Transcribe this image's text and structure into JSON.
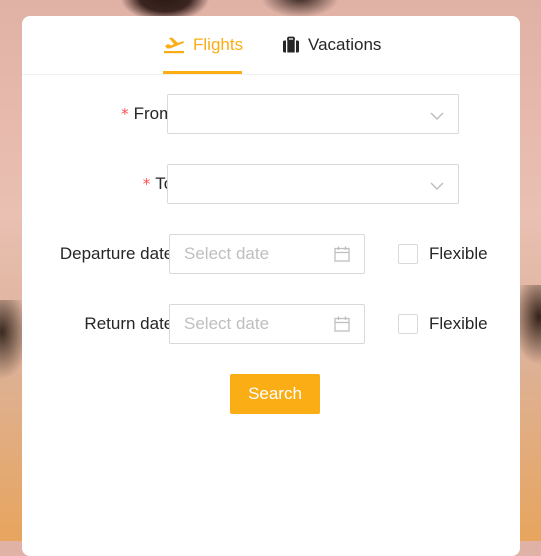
{
  "tabs": [
    {
      "label": "Flights",
      "icon": "airplane-icon",
      "active": true
    },
    {
      "label": "Vacations",
      "icon": "suitcase-icon",
      "active": false
    }
  ],
  "form": {
    "from": {
      "label": "From",
      "required": true,
      "value": ""
    },
    "to": {
      "label": "To",
      "required": true,
      "value": ""
    },
    "departure": {
      "label": "Departure date",
      "placeholder": "Select date",
      "flexible_label": "Flexible",
      "flexible_checked": false
    },
    "return": {
      "label": "Return date",
      "placeholder": "Select date",
      "flexible_label": "Flexible",
      "flexible_checked": false
    },
    "required_mark": "*",
    "colon": ":"
  },
  "actions": {
    "search_label": "Search"
  },
  "colors": {
    "accent": "#faad14",
    "required": "#ff4d4f",
    "border": "#d9d9d9",
    "placeholder": "#bfbfbf"
  }
}
